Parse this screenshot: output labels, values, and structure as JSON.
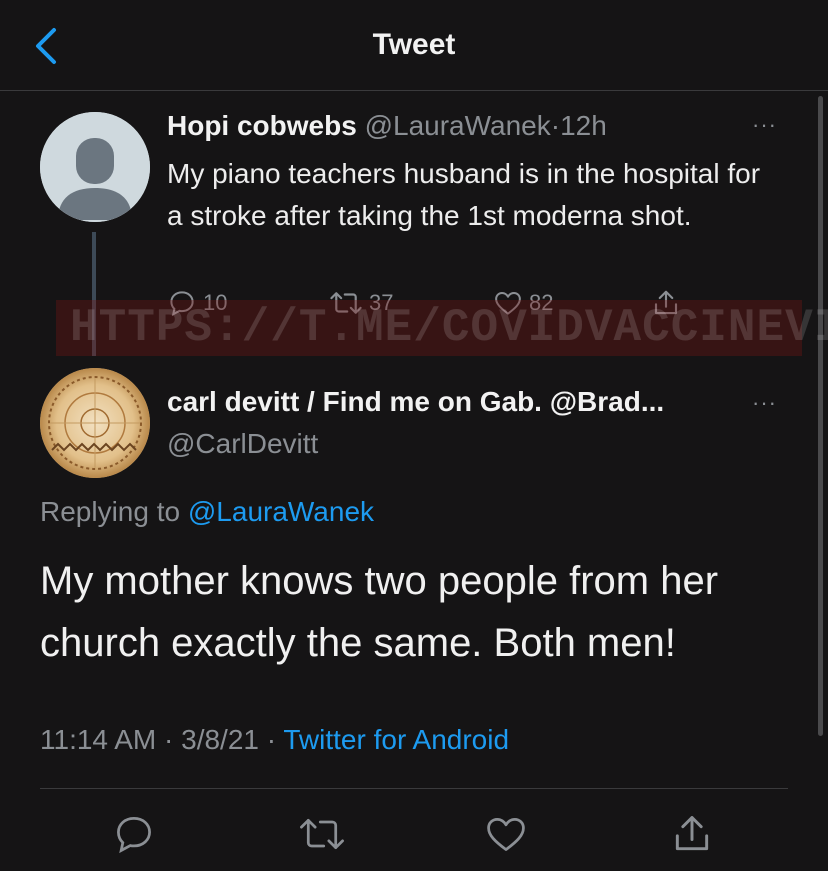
{
  "header": {
    "title": "Tweet",
    "back_icon": "chevron-left-icon"
  },
  "quoted": {
    "display_name": "Hopi cobwebs",
    "handle": "@LauraWanek",
    "sep": "·",
    "time": "12h",
    "text": "My piano teachers husband is in the hospital for a stroke after taking the 1st moderna shot.",
    "replies": "10",
    "retweets": "37",
    "likes": "82"
  },
  "watermark": {
    "text": "HTTPS://T.ME/COVIDVACCINEVICTIMS"
  },
  "tweet": {
    "display_name": "carl devitt / Find me on Gab. @Brad...",
    "handle": "@CarlDevitt",
    "replying_prefix": "Replying to",
    "replying_handle": "@LauraWanek",
    "text": "My mother knows two people from her church exactly the same. Both men!",
    "time": "11:14 AM",
    "sep": "·",
    "date": "3/8/21",
    "source": "Twitter for Android"
  },
  "more": "···",
  "colors": {
    "background": "#151415",
    "accent": "#1d9bf0",
    "muted": "#8b8f94"
  }
}
